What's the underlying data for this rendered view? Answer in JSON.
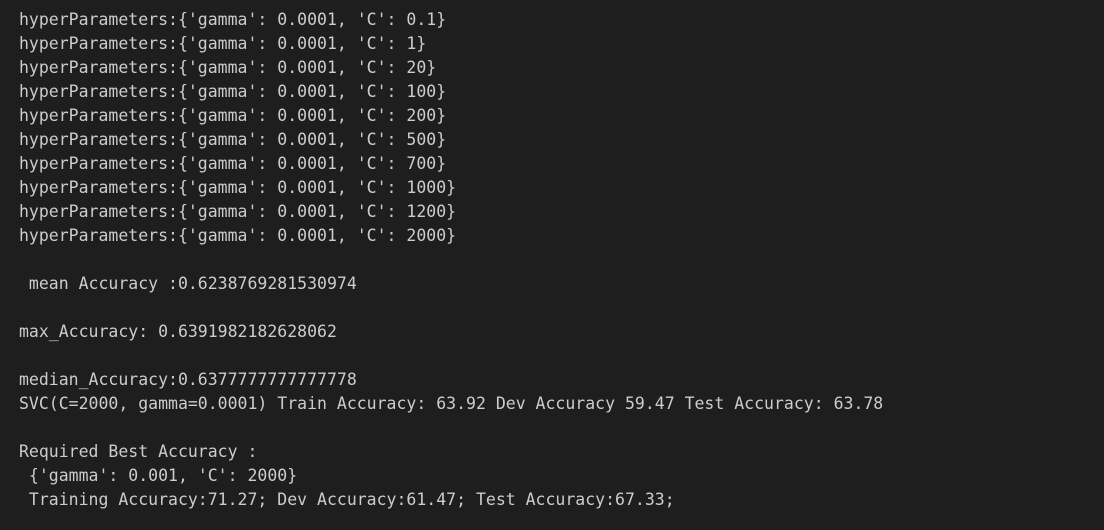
{
  "terminal": {
    "lines": [
      "hyperParameters:{'gamma': 0.0001, 'C': 0.1}",
      "hyperParameters:{'gamma': 0.0001, 'C': 1}",
      "hyperParameters:{'gamma': 0.0001, 'C': 20}",
      "hyperParameters:{'gamma': 0.0001, 'C': 100}",
      "hyperParameters:{'gamma': 0.0001, 'C': 200}",
      "hyperParameters:{'gamma': 0.0001, 'C': 500}",
      "hyperParameters:{'gamma': 0.0001, 'C': 700}",
      "hyperParameters:{'gamma': 0.0001, 'C': 1000}",
      "hyperParameters:{'gamma': 0.0001, 'C': 1200}",
      "hyperParameters:{'gamma': 0.0001, 'C': 2000}",
      "",
      " mean Accuracy :0.6238769281530974",
      "",
      "max_Accuracy: 0.6391982182628062",
      "",
      "median_Accuracy:0.6377777777777778",
      "SVC(C=2000, gamma=0.0001) Train Accuracy: 63.92 Dev Accuracy 59.47 Test Accuracy: 63.78",
      "",
      "Required Best Accuracy :",
      " {'gamma': 0.001, 'C': 2000}",
      " Training Accuracy:71.27; Dev Accuracy:61.47; Test Accuracy:67.33;"
    ],
    "colors": {
      "background": "#1e1e1e",
      "text": "#cccccc"
    }
  }
}
